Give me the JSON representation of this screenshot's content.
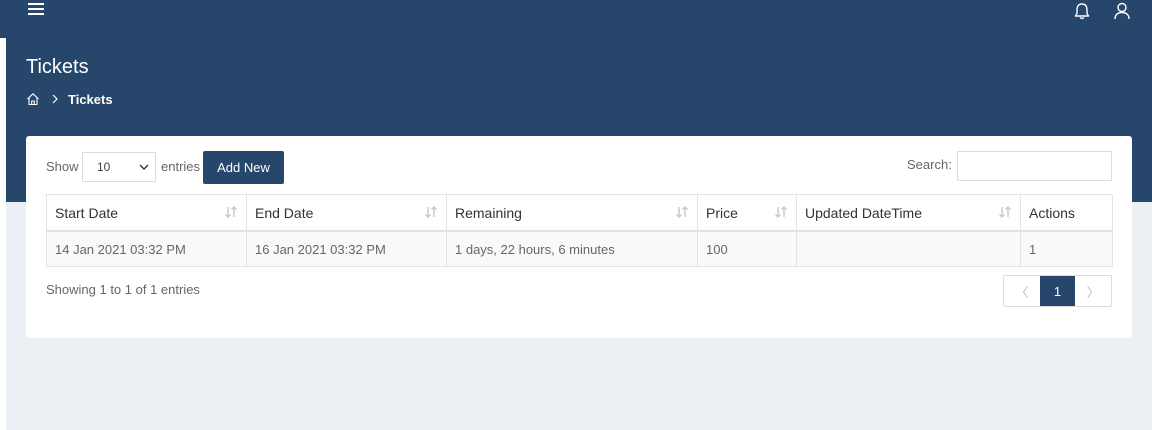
{
  "page": {
    "title": "Tickets"
  },
  "breadcrumb": {
    "current": "Tickets"
  },
  "table_controls": {
    "show_label": "Show",
    "page_length": "10",
    "entries_label": "entries",
    "add_new_label": "Add New",
    "search_label": "Search:",
    "search_value": ""
  },
  "table": {
    "columns": [
      "Start Date",
      "End Date",
      "Remaining",
      "Price",
      "Updated DateTime",
      "Actions"
    ],
    "rows": [
      [
        "14 Jan 2021 03:32 PM",
        "16 Jan 2021 03:32 PM",
        "1 days, 22 hours, 6 minutes",
        "100",
        "",
        "1"
      ]
    ]
  },
  "footer": {
    "info": "Showing 1 to 1 of 1 entries",
    "prev": "〈",
    "current_page": "1",
    "next": "〉"
  },
  "colors": {
    "primary": "#26476b",
    "page_background": "#eceff3"
  },
  "icons": [
    "menu-icon",
    "bell-icon",
    "user-icon",
    "home-icon",
    "chevron-right-icon",
    "sort-icon",
    "chevron-down-icon"
  ]
}
